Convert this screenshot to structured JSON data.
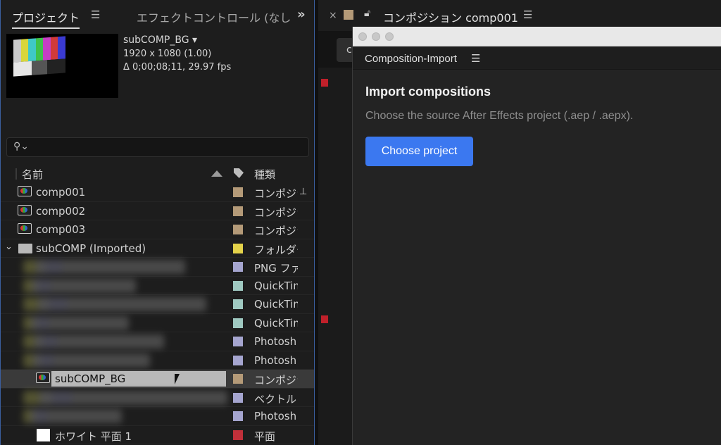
{
  "project_panel": {
    "tab_project": "プロジェクト",
    "tab_menu_icon": "hamburger-icon",
    "tab_effects": "エフェクトコントロール (なし",
    "overflow_icon": "double-chevron-right-icon",
    "preview": {
      "name": "subCOMP_BG ▾",
      "resolution": "1920 x 1080 (1.00)",
      "duration": "Δ 0;00;08;11, 29.97 fps"
    },
    "search": {
      "placeholder": "",
      "icon": "search-icon"
    },
    "columns": {
      "name": "名前",
      "type": "種類"
    },
    "rows": [
      {
        "name": "comp001",
        "type": "コンポジシ",
        "label_color": "#b49a78",
        "icon": "composition-icon"
      },
      {
        "name": "comp002",
        "type": "コンポジシ",
        "label_color": "#b49a78",
        "icon": "composition-icon"
      },
      {
        "name": "comp003",
        "type": "コンポジシ",
        "label_color": "#b49a78",
        "icon": "composition-icon"
      },
      {
        "name": "subCOMP (Imported)",
        "type": "フォルダー",
        "label_color": "#e4d24a",
        "icon": "folder-icon"
      },
      {
        "name": "",
        "type": "PNG ファ",
        "label_color": "#a5a5cf"
      },
      {
        "name": "",
        "type": "QuickTim",
        "label_color": "#9fc9c1"
      },
      {
        "name": "",
        "type": "QuickTim",
        "label_color": "#9fc9c1"
      },
      {
        "name": "",
        "type": "QuickTim",
        "label_color": "#9fc9c1"
      },
      {
        "name": "",
        "type": "Photosh",
        "label_color": "#a5a5cf"
      },
      {
        "name": "",
        "type": "Photosh",
        "label_color": "#a5a5cf"
      },
      {
        "name": "subCOMP_BG",
        "type": "コンポジシ",
        "label_color": "#b49a78",
        "icon": "composition-icon"
      },
      {
        "name": "",
        "type": "ベクトルフ",
        "label_color": "#a5a5cf"
      },
      {
        "name": "",
        "type": "Photosh",
        "label_color": "#a5a5cf"
      },
      {
        "name": "ホワイト 平面 1",
        "type": "平面",
        "label_color": "#c0303a",
        "icon": "solid-icon"
      }
    ]
  },
  "composition_panel": {
    "close": "×",
    "lock_icon": "lock-icon",
    "title": "コンポジション comp001",
    "menu_icon": "hamburger-icon",
    "toolbar_letter": "c"
  },
  "extension": {
    "window_title": "Composition-Import",
    "menu_icon": "hamburger-icon",
    "heading": "Import compositions",
    "description": "Choose the source After Effects project (.aep / .aepx).",
    "button": "Choose project",
    "accent": "#3b78f0"
  }
}
